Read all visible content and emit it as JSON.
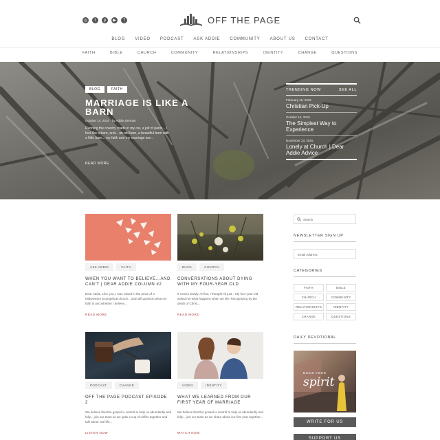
{
  "header": {
    "logo_text": "OFF THE PAGE",
    "social_icons": [
      "instagram-icon",
      "twitter-icon",
      "pinterest-icon",
      "youtube-icon",
      "facebook-icon"
    ],
    "nav_primary": [
      "BLOG",
      "VIDEO",
      "PODCAST",
      "ASK ADDIE",
      "COMMUNITY",
      "ABOUT US",
      "CONTACT"
    ],
    "nav_secondary": [
      "FAITH",
      "BIBLE",
      "CHURCH",
      "COMMUNITY",
      "RELATIONSHIPS",
      "IDENTITY",
      "CHANGE",
      "QUESTIONS"
    ]
  },
  "hero": {
    "tags": [
      "BLOG",
      "FAITH"
    ],
    "title": "MARRIAGE IS LIKE A BARN",
    "meta": "October 14, 2015 · by Addie Zierman",
    "excerpt": "Running the country roads in my car, a jolt of panic... I feel like a barn, and... an old barn, a beautiful barn with a little barn... my faith and my marriage are...",
    "read_more": "READ MORE"
  },
  "trending": {
    "label": "TRENDING NOW",
    "see_all": "SEE ALL",
    "items": [
      {
        "date": "February 10, 2015",
        "title": "Christian Pick-Up"
      },
      {
        "date": "October 16, 2015",
        "title": "The Simplest Way to Experience"
      },
      {
        "date": "November 23, 2015",
        "title": "Lonely at Church | Dear Addie Advice"
      }
    ]
  },
  "posts": [
    {
      "tags": [
        "ASK ADDIE",
        "FAITH"
      ],
      "title": "WHEN YOU WANT TO BELIEVE...AND CAN'T | DEAR ADDIE COLUMN #2",
      "excerpt": "Dear Addie, Like you, I was raised in the pews of a Midwestern Evangelical church... and still question what my faith is and whether I believe...",
      "read_more": "READ MORE"
    },
    {
      "tags": [
        "BLOG",
        "CHURCH"
      ],
      "title": "CONVERSATIONS ABOUT DYING WITH MY FOUR-YEAR OLD",
      "excerpt": "It comes slowly. At first, I thought I'd just... My four-year-old asked me what happens when we die. Recognizing by the death of Christ...",
      "read_more": "READ MORE"
    },
    {
      "tags": [
        "PODCAST",
        "CHANGE"
      ],
      "title": "OFF THE PAGE PODCAST EPISODE 2",
      "excerpt": "We believe that the gospel is central to help us abundantly and fully... join our team as we grab a cup of coffee together and talk about real life...",
      "read_more": "LISTEN NOW"
    },
    {
      "tags": [
        "VIDEO",
        "IDENTITY"
      ],
      "title": "WHAT WE LEARNED FROM OUR FIRST YEAR OF MARRIAGE",
      "excerpt": "We believe that the gospel is central to help us abundantly and fully... join our team as we share about our first year together...",
      "read_more": "WATCH NOW"
    }
  ],
  "sidebar": {
    "search_placeholder": "Search",
    "newsletter_label": "NEWSLETTER SIGN UP",
    "email_placeholder": "Email Address",
    "categories_label": "CATEGORIES",
    "categories": [
      "FAITH",
      "BIBLE",
      "CHURCH",
      "COMMUNITY",
      "RELATIONSHIPS",
      "IDENTITY",
      "CHANGE",
      "QUESTIONS"
    ],
    "devotional_label": "DAILY DEVOTIONAL",
    "devotional_small": "BUILD YOUR",
    "devotional_big": "spirit",
    "write_button": "WRITE FOR US",
    "support_button": "SUPPORT US"
  }
}
